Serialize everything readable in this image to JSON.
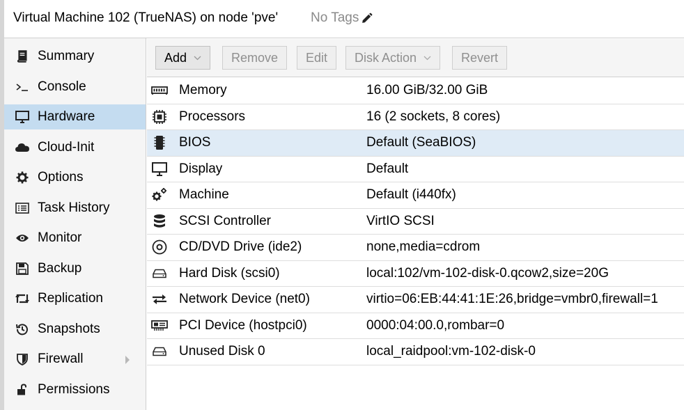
{
  "header": {
    "title": "Virtual Machine 102 (TrueNAS) on node 'pve'",
    "tags_label": "No Tags"
  },
  "sidebar": {
    "items": [
      {
        "label": "Summary",
        "icon": "book-icon"
      },
      {
        "label": "Console",
        "icon": "terminal-icon"
      },
      {
        "label": "Hardware",
        "icon": "monitor-icon",
        "selected": true
      },
      {
        "label": "Cloud-Init",
        "icon": "cloud-icon"
      },
      {
        "label": "Options",
        "icon": "gear-icon"
      },
      {
        "label": "Task History",
        "icon": "list-icon"
      },
      {
        "label": "Monitor",
        "icon": "eye-icon"
      },
      {
        "label": "Backup",
        "icon": "floppy-icon"
      },
      {
        "label": "Replication",
        "icon": "retweet-icon"
      },
      {
        "label": "Snapshots",
        "icon": "history-icon"
      },
      {
        "label": "Firewall",
        "icon": "shield-icon",
        "has_submenu": true
      },
      {
        "label": "Permissions",
        "icon": "unlock-icon"
      }
    ]
  },
  "toolbar": {
    "add_label": "Add",
    "remove_label": "Remove",
    "edit_label": "Edit",
    "disk_action_label": "Disk Action",
    "revert_label": "Revert"
  },
  "hardware": {
    "rows": [
      {
        "name": "Memory",
        "value": "16.00 GiB/32.00 GiB",
        "icon": "memory-icon"
      },
      {
        "name": "Processors",
        "value": "16 (2 sockets, 8 cores)",
        "icon": "cpu-icon"
      },
      {
        "name": "BIOS",
        "value": "Default (SeaBIOS)",
        "icon": "microchip-icon",
        "selected": true
      },
      {
        "name": "Display",
        "value": "Default",
        "icon": "desktop-icon"
      },
      {
        "name": "Machine",
        "value": "Default (i440fx)",
        "icon": "cogs-icon"
      },
      {
        "name": "SCSI Controller",
        "value": "VirtIO SCSI",
        "icon": "database-icon"
      },
      {
        "name": "CD/DVD Drive (ide2)",
        "value": "none,media=cdrom",
        "icon": "cdrom-icon"
      },
      {
        "name": "Hard Disk (scsi0)",
        "value": "local:102/vm-102-disk-0.qcow2,size=20G",
        "icon": "hdd-icon"
      },
      {
        "name": "Network Device (net0)",
        "value": "virtio=06:EB:44:41:1E:26,bridge=vmbr0,firewall=1",
        "icon": "exchange-icon"
      },
      {
        "name": "PCI Device (hostpci0)",
        "value": "0000:04:00.0,rombar=0",
        "icon": "pci-card-icon"
      },
      {
        "name": "Unused Disk 0",
        "value": "local_raidpool:vm-102-disk-0",
        "icon": "hdd-icon"
      }
    ]
  }
}
